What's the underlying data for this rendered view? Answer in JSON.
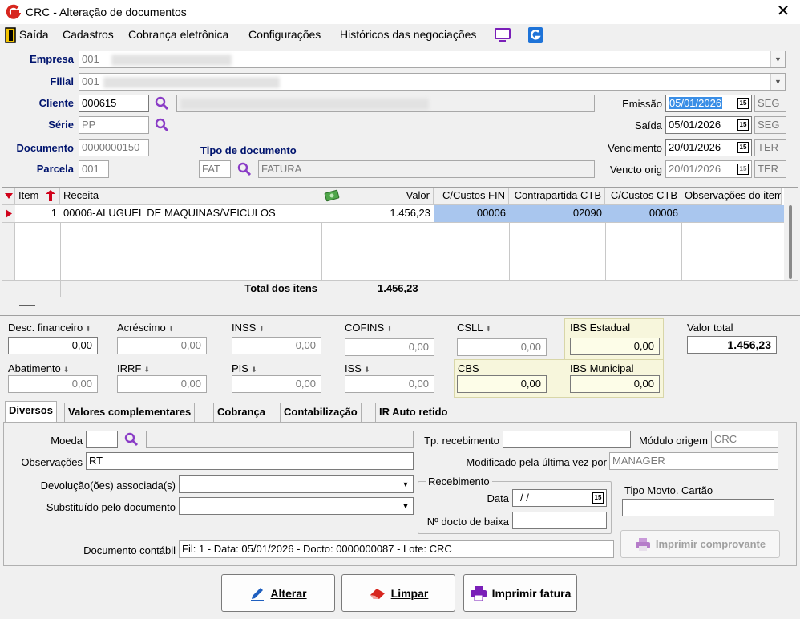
{
  "window": {
    "title": "CRC - Alteração de documentos",
    "close_glyph": "✕"
  },
  "menu": {
    "items": [
      "Saída",
      "Cadastros",
      "Cobrança eletrônica",
      "Configurações",
      "Históricos das negociações"
    ]
  },
  "header": {
    "empresa_label": "Empresa",
    "empresa_value": "001",
    "filial_label": "Filial",
    "filial_value": "001",
    "cliente_label": "Cliente",
    "cliente_value": "000615",
    "serie_label": "Série",
    "serie_value": "PP",
    "documento_label": "Documento",
    "documento_value": "0000000150",
    "parcela_label": "Parcela",
    "parcela_value": "001",
    "tipo_doc_label": "Tipo de documento",
    "tipo_doc_code": "FAT",
    "tipo_doc_desc": "FATURA",
    "emissao_label": "Emissão",
    "emissao_value": "05/01/2026",
    "emissao_day": "SEG",
    "saida_label": "Saída",
    "saida_value": "05/01/2026",
    "saida_day": "SEG",
    "vencimento_label": "Vencimento",
    "vencimento_value": "20/01/2026",
    "vencimento_day": "TER",
    "vencto_orig_label": "Vencto orig",
    "vencto_orig_value": "20/01/2026",
    "vencto_orig_day": "TER"
  },
  "grid": {
    "columns": [
      "Item",
      "Receita",
      "Valor",
      "C/Custos FIN",
      "Contrapartida CTB",
      "C/Custos CTB",
      "Observações do item"
    ],
    "rows": [
      {
        "item": "1",
        "receita": "00006-ALUGUEL DE MAQUINAS/VEICULOS",
        "valor": "1.456,23",
        "ccfin": "00006",
        "contrapartida": "02090",
        "ccctb": "00006",
        "obs": ""
      }
    ],
    "total_label": "Total dos itens",
    "total_value": "1.456,23"
  },
  "taxes": {
    "desc_fin_label": "Desc. financeiro",
    "desc_fin": "0,00",
    "acrescimo_label": "Acréscimo",
    "acrescimo": "0,00",
    "inss_label": "INSS",
    "inss": "0,00",
    "cofins_label": "COFINS",
    "cofins": "0,00",
    "csll_label": "CSLL",
    "csll": "0,00",
    "ibs_estadual_label": "IBS Estadual",
    "ibs_estadual": "0,00",
    "valor_total_label": "Valor total",
    "valor_total": "1.456,23",
    "abatimento_label": "Abatimento",
    "abatimento": "0,00",
    "irrf_label": "IRRF",
    "irrf": "0,00",
    "pis_label": "PIS",
    "pis": "0,00",
    "iss_label": "ISS",
    "iss": "0,00",
    "cbs_label": "CBS",
    "cbs": "0,00",
    "ibs_municipal_label": "IBS Municipal",
    "ibs_municipal": "0,00"
  },
  "tabs": [
    "Diversos",
    "Valores complementares",
    "Cobrança",
    "Contabilização",
    "IR Auto retido"
  ],
  "diversos": {
    "moeda_label": "Moeda",
    "moeda_value": "",
    "observacoes_label": "Observações",
    "observacoes_value": "RT",
    "devolucoes_label": "Devolução(ões) associada(s)",
    "substituido_label": "Substituído pelo documento",
    "tp_recebimento_label": "Tp. recebimento",
    "tp_recebimento_value": "",
    "modulo_origem_label": "Módulo origem",
    "modulo_origem_value": "CRC",
    "modificado_label": "Modificado pela última vez por",
    "modificado_value": "MANAGER",
    "recebimento_group": "Recebimento",
    "data_label": "Data",
    "data_value": "/ /",
    "docto_baixa_label": "Nº docto de baixa",
    "docto_baixa_value": "",
    "tipo_movto_label": "Tipo Movto. Cartão",
    "tipo_movto_value": "",
    "imprimir_comprovante": "Imprimir comprovante",
    "doc_contabil_label": "Documento contábil",
    "doc_contabil_value": "Fil: 1 - Data: 05/01/2026 - Docto: 0000000087 - Lote: CRC"
  },
  "actions": {
    "alterar": "Alterar",
    "limpar": "Limpar",
    "imprimir_fatura": "Imprimir fatura"
  },
  "colors": {
    "accent": "#00146e",
    "selection": "#a9c6ee",
    "highlight": "#3a8ee6",
    "ibs_bg": "#f7f6dc"
  }
}
